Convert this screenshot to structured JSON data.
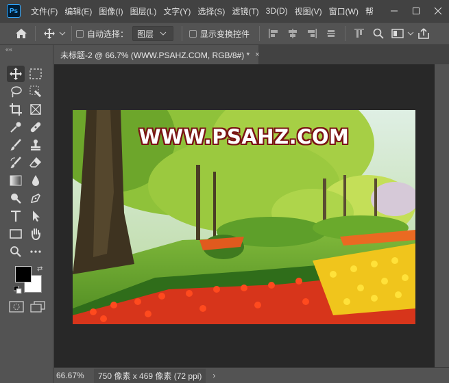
{
  "app": {
    "logo": "Ps"
  },
  "menu": {
    "items": [
      "文件(F)",
      "编辑(E)",
      "图像(I)",
      "图层(L)",
      "文字(Y)",
      "选择(S)",
      "滤镜(T)",
      "3D(D)",
      "视图(V)",
      "窗口(W)",
      "帮"
    ]
  },
  "window_controls": {
    "icons": [
      "minimize-icon",
      "maximize-icon",
      "close-icon"
    ]
  },
  "options": {
    "auto_select_label": "自动选择：",
    "layer_select_value": "图层",
    "show_transform_label": "显示变换控件"
  },
  "tools": {
    "collapse_label": "««",
    "items": [
      "move-tool",
      "marquee-tool",
      "lasso-tool",
      "quick-select-tool",
      "crop-tool",
      "frame-tool",
      "eyedropper-tool",
      "healing-brush-tool",
      "brush-tool",
      "clone-stamp-tool",
      "history-brush-tool",
      "eraser-tool",
      "gradient-tool",
      "blur-tool",
      "dodge-tool",
      "pen-tool",
      "type-tool",
      "path-select-tool",
      "rectangle-tool",
      "hand-tool",
      "zoom-tool",
      "more-tools"
    ],
    "foreground_color": "#000000",
    "background_color": "#ffffff"
  },
  "document": {
    "tab_title": "未标题-2 @ 66.7% (WWW.PSAHZ.COM, RGB/8#) *",
    "tab_close": "×",
    "watermark_text": "WWW.PSAHZ.COM"
  },
  "status": {
    "zoom": "66.67%",
    "doc_info": "750 像素 x 469 像素 (72 ppi)",
    "arrow": "›"
  },
  "colors": {
    "accent": "#31a8ff",
    "canvas_bg": "#282828",
    "panel_bg": "#535353",
    "watermark_outline": "#7a1414"
  }
}
